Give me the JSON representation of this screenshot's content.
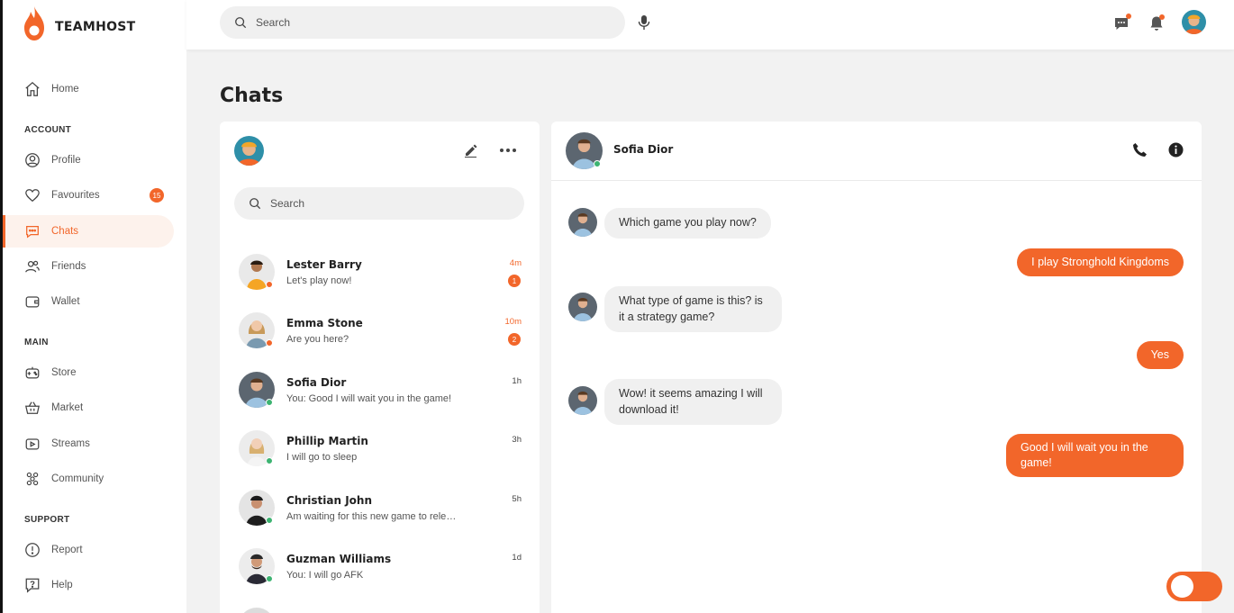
{
  "brand": {
    "name": "TEAMHOST"
  },
  "search": {
    "placeholder": "Search"
  },
  "nav": {
    "home": "Home",
    "sections": {
      "account": "ACCOUNT",
      "main": "MAIN",
      "support": "SUPPORT"
    },
    "profile": "Profile",
    "favourites": "Favourites",
    "favourites_badge": "15",
    "chats": "Chats",
    "friends": "Friends",
    "wallet": "Wallet",
    "store": "Store",
    "market": "Market",
    "streams": "Streams",
    "community": "Community",
    "report": "Report",
    "help": "Help"
  },
  "page": {
    "title": "Chats"
  },
  "chat_list": {
    "search_placeholder": "Search",
    "contacts": [
      {
        "name": "Lester Barry",
        "message": "Let's play now!",
        "time": "4m",
        "unread": "1",
        "status": "away"
      },
      {
        "name": "Emma Stone",
        "message": "Are you here?",
        "time": "10m",
        "unread": "2",
        "status": "away"
      },
      {
        "name": "Sofia Dior",
        "message": "You: Good I will wait you in the game!",
        "time": "1h",
        "status": "online"
      },
      {
        "name": "Phillip Martin",
        "message": "I will go to sleep",
        "time": "3h",
        "status": "online"
      },
      {
        "name": "Christian John",
        "message": "Am waiting for this new game to release",
        "time": "5h",
        "status": "online"
      },
      {
        "name": "Guzman Williams",
        "message": "You: I will go AFK",
        "time": "1d",
        "status": "online"
      }
    ]
  },
  "conversation": {
    "contact_name": "Sofia Dior",
    "messages": [
      {
        "from": "them",
        "text": "Which game you play now?"
      },
      {
        "from": "me",
        "text": "I play Stronghold Kingdoms"
      },
      {
        "from": "them",
        "text": "What type of game is this? is it a strategy game?"
      },
      {
        "from": "me",
        "text": "Yes"
      },
      {
        "from": "them",
        "text": "Wow! it seems amazing I will download it!"
      },
      {
        "from": "me",
        "text": "Good I will wait you in the game!"
      }
    ]
  },
  "colors": {
    "accent": "#f2662a",
    "online": "#3cb371",
    "away": "#f2662a"
  }
}
